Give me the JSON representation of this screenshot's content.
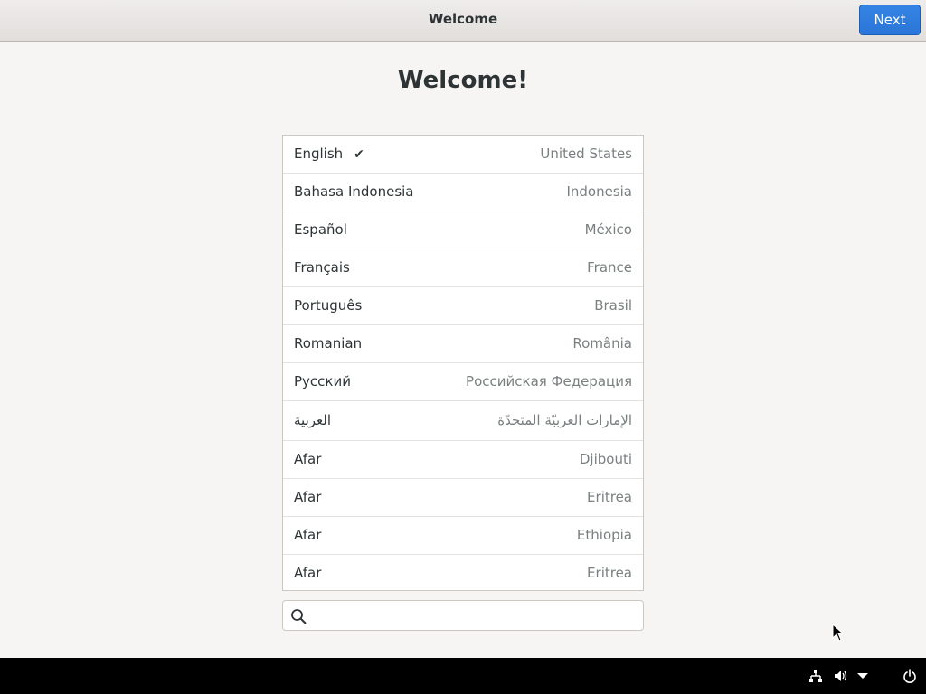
{
  "header": {
    "title": "Welcome",
    "next_label": "Next"
  },
  "main": {
    "title": "Welcome!"
  },
  "languages": [
    {
      "name": "English",
      "region": "United States",
      "selected": true
    },
    {
      "name": "Bahasa Indonesia",
      "region": "Indonesia",
      "selected": false
    },
    {
      "name": "Español",
      "region": "México",
      "selected": false
    },
    {
      "name": "Français",
      "region": "France",
      "selected": false
    },
    {
      "name": "Português",
      "region": "Brasil",
      "selected": false
    },
    {
      "name": "Romanian",
      "region": "România",
      "selected": false
    },
    {
      "name": "Русский",
      "region": "Российская Федерация",
      "selected": false
    },
    {
      "name": "العربية",
      "region": "الإمارات العربيّة المتحدّة",
      "selected": false
    },
    {
      "name": "Afar",
      "region": "Djibouti",
      "selected": false
    },
    {
      "name": "Afar",
      "region": "Eritrea",
      "selected": false
    },
    {
      "name": "Afar",
      "region": "Ethiopia",
      "selected": false
    },
    {
      "name": "Afar",
      "region": "Eritrea",
      "selected": false
    }
  ],
  "search": {
    "value": "",
    "icon": "search-icon"
  },
  "taskbar": {
    "icons": [
      "network-icon",
      "volume-icon",
      "dropdown-arrow-icon",
      "power-icon"
    ]
  },
  "colors": {
    "accent": "#3584e4",
    "background": "#f6f5f4",
    "taskbar": "#000000"
  }
}
